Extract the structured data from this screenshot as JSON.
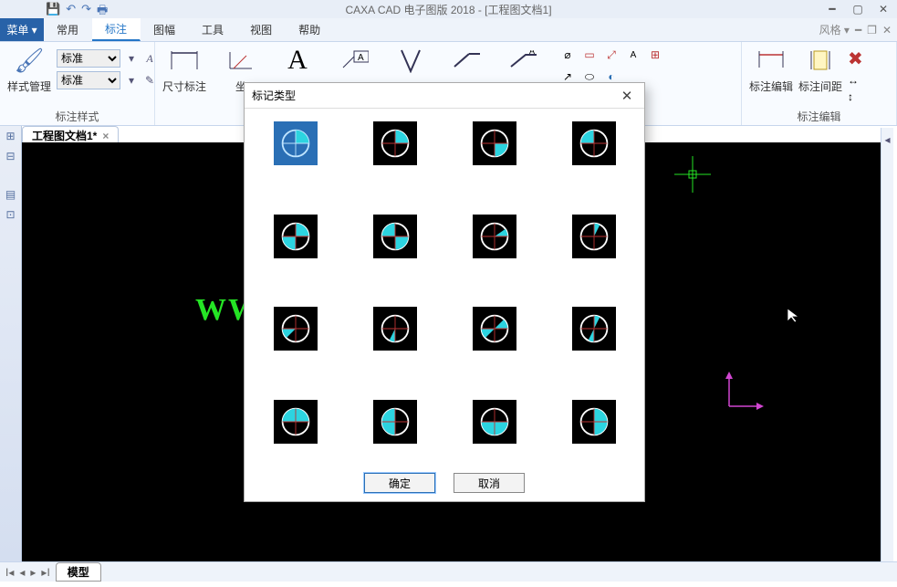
{
  "app": {
    "title": "CAXA CAD 电子图版 2018 - [工程图文档1]"
  },
  "menu": {
    "button": "菜单 ▾",
    "tabs": [
      "常用",
      "标注",
      "图幅",
      "工具",
      "视图",
      "帮助"
    ],
    "active_index": 1,
    "style_label": "风格 ▾"
  },
  "ribbon": {
    "group1": {
      "label": "标注样式",
      "btn": "样式管理",
      "combo1": "标准",
      "combo2": "标准"
    },
    "group2": {
      "label": "",
      "btn1": "尺寸标注",
      "btn2": "坐"
    },
    "group3": {
      "btn1": "A"
    },
    "group4": {
      "label": "标注编辑",
      "btn1": "标注编辑",
      "btn2": "标注间距"
    }
  },
  "document": {
    "tab": "工程图文档1*",
    "model_tab": "模型",
    "watermark": "WWW"
  },
  "dialog": {
    "title": "标记类型",
    "ok": "确定",
    "cancel": "取消",
    "selected_index": 0
  }
}
